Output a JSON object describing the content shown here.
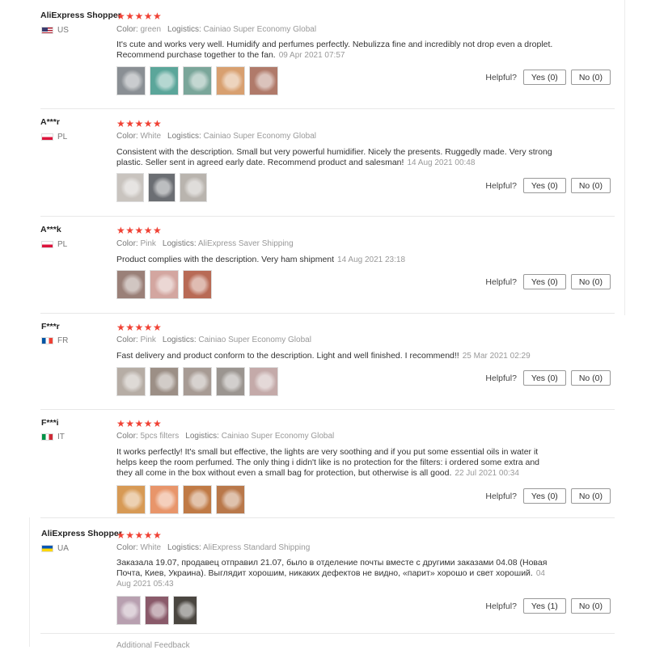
{
  "ui": {
    "helpful_label": "Helpful?",
    "additional_feedback": "Additional Feedback"
  },
  "reviews": [
    {
      "name": "AliExpress Shopper",
      "country": "US",
      "flag": "us",
      "stars": "★★★★★",
      "meta": [
        {
          "k": "Color:",
          "v": "green"
        },
        {
          "k": "Logistics:",
          "v": "Cainiao Super Economy Global"
        }
      ],
      "text": "It's cute and works very well. Humidify and perfumes perfectly. Nebulizza fine and incredibly not drop even a droplet. Recommend purchase together to the fan.",
      "date": "09 Apr 2021 07:57",
      "thumbs": [
        "#8a8f94",
        "#5ba69a",
        "#7aa69a",
        "#d8a070",
        "#b07a6a"
      ],
      "yes": "Yes (0)",
      "no": "No (0)"
    },
    {
      "name": "A***r",
      "country": "PL",
      "flag": "pl",
      "stars": "★★★★★",
      "meta": [
        {
          "k": "Color:",
          "v": "White"
        },
        {
          "k": "Logistics:",
          "v": "Cainiao Super Economy Global"
        }
      ],
      "text": "Consistent with the description. Small but very powerful humidifier. Nicely the presents. Ruggedly made. Very strong plastic. Seller sent in agreed early date. Recommend product and salesman!",
      "date": "14 Aug 2021 00:48",
      "thumbs": [
        "#c9c4bf",
        "#6b6e73",
        "#b9b4ae"
      ],
      "yes": "Yes (0)",
      "no": "No (0)"
    },
    {
      "name": "A***k",
      "country": "PL",
      "flag": "pl",
      "stars": "★★★★★",
      "meta": [
        {
          "k": "Color:",
          "v": "Pink"
        },
        {
          "k": "Logistics:",
          "v": "AliExpress Saver Shipping"
        }
      ],
      "text": "Product complies with the description. Very ham shipment",
      "date": "14 Aug 2021 23:18",
      "thumbs": [
        "#9a8078",
        "#d3a6a0",
        "#b86a55"
      ],
      "yes": "Yes (0)",
      "no": "No (0)"
    },
    {
      "name": "F***r",
      "country": "FR",
      "flag": "fr",
      "stars": "★★★★★",
      "meta": [
        {
          "k": "Color:",
          "v": "Pink"
        },
        {
          "k": "Logistics:",
          "v": "Cainiao Super Economy Global"
        }
      ],
      "text": "Fast delivery and product conform to the description. Light and well finished. I recommend!!",
      "date": "25 Mar 2021 02:29",
      "thumbs": [
        "#b6ada5",
        "#9c8f86",
        "#a79b94",
        "#9b9590",
        "#c4aaa9"
      ],
      "yes": "Yes (0)",
      "no": "No (0)"
    },
    {
      "name": "F***i",
      "country": "IT",
      "flag": "it",
      "stars": "★★★★★",
      "meta": [
        {
          "k": "Color:",
          "v": "5pcs filters"
        },
        {
          "k": "Logistics:",
          "v": "Cainiao Super Economy Global"
        }
      ],
      "text": "It works perfectly! It's small but effective, the lights are very soothing and if you put some essential oils in water it helps keep the room perfumed. The only thing i didn't like is no protection for the filters: i ordered some extra and they all come in the box without even a small bag for protection, but otherwise is all good.",
      "date": "22 Jul 2021 00:34",
      "thumbs": [
        "#d79a55",
        "#e8956a",
        "#c07a45",
        "#b9784a"
      ],
      "yes": "Yes (0)",
      "no": "No (0)"
    },
    {
      "name": "AliExpress Shopper",
      "country": "UA",
      "flag": "ua",
      "stars": "★★★★★",
      "meta": [
        {
          "k": "Color:",
          "v": "White"
        },
        {
          "k": "Logistics:",
          "v": "AliExpress Standard Shipping"
        }
      ],
      "text": "Заказала 19.07, продавец отправил 21.07, было в отделение почты вместе с другими заказами 04.08 (Новая Почта, Киев, Украина). Выглядит хорошим, никаких дефектов не видно, «парит» хорошо и свет хороший.",
      "date": "04 Aug 2021 05:43",
      "thumbs": [
        "#b8a0b0",
        "#8a5a6a",
        "#4a4640"
      ],
      "yes": "Yes (1)",
      "no": "No (0)"
    }
  ]
}
